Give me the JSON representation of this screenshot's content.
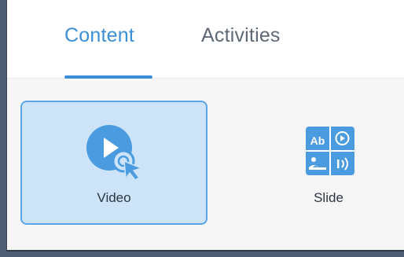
{
  "tabs": [
    {
      "label": "Content",
      "active": true
    },
    {
      "label": "Activities",
      "active": false
    }
  ],
  "tiles": [
    {
      "label": "Video",
      "selected": true,
      "icon": "video-play-icon"
    },
    {
      "label": "Slide",
      "selected": false,
      "icon": "slide-icon"
    }
  ],
  "slide_icon_text": "Ab",
  "colors": {
    "accent": "#3a8fd8",
    "selected_tile_bg": "#cde4f8",
    "selected_tile_border": "#5aa5e6",
    "icon_blue": "#4a9be0"
  }
}
